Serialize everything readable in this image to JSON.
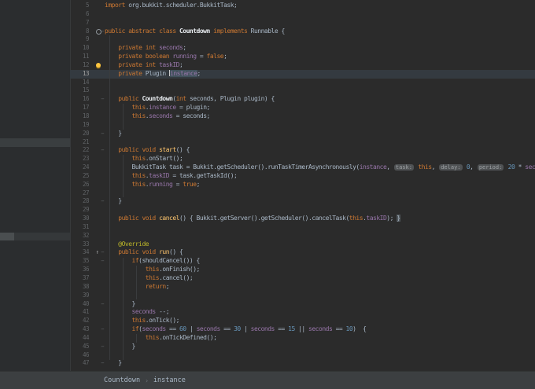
{
  "colors": {
    "bg": "#2b2b2b",
    "panel": "#2b2d2f",
    "bar": "#3c3f41",
    "lineNum": "#606366",
    "lineNumActive": "#a4a3a3",
    "kw": "#cc7832",
    "pl": "#a9b7c6",
    "fld": "#9876aa",
    "mth": "#ffc66d",
    "num": "#6897bb",
    "ann": "#bbb529",
    "cls": "#e8ecf0",
    "hintBg": "#4f5254",
    "hintFg": "#9da1a4",
    "caretLine": "#343a40",
    "sel": "#41525c",
    "brace": "#50565a",
    "crumb": "#a9b7c6",
    "bulb": "#fdc53f"
  },
  "icons": {
    "bulb": "intention-bulb-icon",
    "override": "overriding-method-icon",
    "marker": "class-marker-icon",
    "fold": "fold-marker-icon"
  },
  "breadcrumbs": {
    "items": [
      "Countdown",
      "instance"
    ],
    "separator": "›"
  },
  "editor": {
    "lines": [
      {
        "n": 5,
        "segs": [
          [
            "kw",
            "import"
          ],
          [
            "pl",
            " org.bukkit.scheduler.BukkitTask;"
          ]
        ]
      },
      {
        "n": 6,
        "segs": []
      },
      {
        "n": 7,
        "segs": []
      },
      {
        "n": 8,
        "icon": "marker",
        "fold": true,
        "segs": [
          [
            "kw",
            "public abstract class "
          ],
          [
            "cls",
            "Countdown"
          ],
          [
            "pl",
            " "
          ],
          [
            "kw",
            "implements"
          ],
          [
            "pl",
            " Runnable {"
          ]
        ]
      },
      {
        "n": 9,
        "segs": []
      },
      {
        "n": 10,
        "segs": [
          [
            "pl",
            "    "
          ],
          [
            "kw",
            "private int "
          ],
          [
            "fld",
            "seconds"
          ],
          [
            "pl",
            ";"
          ]
        ]
      },
      {
        "n": 11,
        "segs": [
          [
            "pl",
            "    "
          ],
          [
            "kw",
            "private boolean "
          ],
          [
            "fld",
            "running"
          ],
          [
            "pl",
            " = "
          ],
          [
            "kw",
            "false"
          ],
          [
            "pl",
            ";"
          ]
        ]
      },
      {
        "n": 12,
        "icon": "bulb",
        "segs": [
          [
            "pl",
            "    "
          ],
          [
            "kw",
            "private int "
          ],
          [
            "fld",
            "taskID"
          ],
          [
            "pl",
            ";"
          ]
        ]
      },
      {
        "n": 13,
        "caretLine": true,
        "segs": [
          [
            "pl",
            "    "
          ],
          [
            "kw",
            "private"
          ],
          [
            "pl",
            " Plugin "
          ],
          [
            "caret",
            ""
          ],
          [
            "sel",
            "instance"
          ],
          [
            "pl",
            ";"
          ]
        ]
      },
      {
        "n": 14,
        "segs": []
      },
      {
        "n": 15,
        "segs": []
      },
      {
        "n": 16,
        "fold": true,
        "segs": [
          [
            "pl",
            "    "
          ],
          [
            "kw",
            "public "
          ],
          [
            "cls",
            "Countdown"
          ],
          [
            "pl",
            "("
          ],
          [
            "kw",
            "int"
          ],
          [
            "pl",
            " seconds, Plugin plugin) {"
          ]
        ]
      },
      {
        "n": 17,
        "segs": [
          [
            "pl",
            "        "
          ],
          [
            "kw",
            "this"
          ],
          [
            "pl",
            "."
          ],
          [
            "fld",
            "instance"
          ],
          [
            "pl",
            " = plugin;"
          ]
        ]
      },
      {
        "n": 18,
        "segs": [
          [
            "pl",
            "        "
          ],
          [
            "kw",
            "this"
          ],
          [
            "pl",
            "."
          ],
          [
            "fld",
            "seconds"
          ],
          [
            "pl",
            " = seconds;"
          ]
        ]
      },
      {
        "n": 19,
        "segs": []
      },
      {
        "n": 20,
        "fold": true,
        "segs": [
          [
            "pl",
            "    }"
          ]
        ]
      },
      {
        "n": 21,
        "segs": []
      },
      {
        "n": 22,
        "fold": true,
        "segs": [
          [
            "pl",
            "    "
          ],
          [
            "kw",
            "public void "
          ],
          [
            "mth",
            "start"
          ],
          [
            "pl",
            "() {"
          ]
        ]
      },
      {
        "n": 23,
        "segs": [
          [
            "pl",
            "        "
          ],
          [
            "kw",
            "this"
          ],
          [
            "pl",
            ".onStart();"
          ]
        ]
      },
      {
        "n": 24,
        "segs": [
          [
            "pl",
            "        BukkitTask task = Bukkit.getScheduler().runTaskTimerAsynchronously("
          ],
          [
            "fld",
            "instance"
          ],
          [
            "pl",
            ", "
          ],
          [
            "hint",
            "task:"
          ],
          [
            "pl",
            " "
          ],
          [
            "kw",
            "this"
          ],
          [
            "pl",
            ", "
          ],
          [
            "hint",
            "delay:"
          ],
          [
            "pl",
            " "
          ],
          [
            "num",
            "0"
          ],
          [
            "pl",
            ", "
          ],
          [
            "hint",
            "period:"
          ],
          [
            "pl",
            " "
          ],
          [
            "num",
            "20"
          ],
          [
            "pl",
            " * "
          ],
          [
            "fld",
            "seconds"
          ],
          [
            "pl",
            ");"
          ]
        ]
      },
      {
        "n": 25,
        "segs": [
          [
            "pl",
            "        "
          ],
          [
            "kw",
            "this"
          ],
          [
            "pl",
            "."
          ],
          [
            "fld",
            "taskID"
          ],
          [
            "pl",
            " = task.getTaskId();"
          ]
        ]
      },
      {
        "n": 26,
        "segs": [
          [
            "pl",
            "        "
          ],
          [
            "kw",
            "this"
          ],
          [
            "pl",
            "."
          ],
          [
            "fld",
            "running"
          ],
          [
            "pl",
            " = "
          ],
          [
            "kw",
            "true"
          ],
          [
            "pl",
            ";"
          ]
        ]
      },
      {
        "n": 27,
        "segs": []
      },
      {
        "n": 28,
        "fold": true,
        "segs": [
          [
            "pl",
            "    }"
          ]
        ]
      },
      {
        "n": 29,
        "segs": []
      },
      {
        "n": 30,
        "segs": [
          [
            "pl",
            "    "
          ],
          [
            "kw",
            "public void "
          ],
          [
            "mth",
            "cancel"
          ],
          [
            "pl",
            "() { Bukkit.getServer().getScheduler().cancelTask("
          ],
          [
            "kw",
            "this"
          ],
          [
            "pl",
            "."
          ],
          [
            "fld",
            "taskID"
          ],
          [
            "pl",
            "); "
          ],
          [
            "brc",
            "}"
          ]
        ]
      },
      {
        "n": 31,
        "segs": []
      },
      {
        "n": 32,
        "segs": []
      },
      {
        "n": 33,
        "segs": [
          [
            "pl",
            "    "
          ],
          [
            "ann",
            "@Override"
          ]
        ]
      },
      {
        "n": 34,
        "icon": "override",
        "fold": true,
        "segs": [
          [
            "pl",
            "    "
          ],
          [
            "kw",
            "public void "
          ],
          [
            "mth",
            "run"
          ],
          [
            "pl",
            "() {"
          ]
        ]
      },
      {
        "n": 35,
        "fold": true,
        "segs": [
          [
            "pl",
            "        "
          ],
          [
            "kw",
            "if"
          ],
          [
            "pl",
            "(shouldCancel()) {"
          ]
        ]
      },
      {
        "n": 36,
        "segs": [
          [
            "pl",
            "            "
          ],
          [
            "kw",
            "this"
          ],
          [
            "pl",
            ".onFinish();"
          ]
        ]
      },
      {
        "n": 37,
        "segs": [
          [
            "pl",
            "            "
          ],
          [
            "kw",
            "this"
          ],
          [
            "pl",
            ".cancel();"
          ]
        ]
      },
      {
        "n": 38,
        "segs": [
          [
            "pl",
            "            "
          ],
          [
            "kw",
            "return"
          ],
          [
            "pl",
            ";"
          ]
        ]
      },
      {
        "n": 39,
        "segs": []
      },
      {
        "n": 40,
        "fold": true,
        "segs": [
          [
            "pl",
            "        }"
          ]
        ]
      },
      {
        "n": 41,
        "segs": [
          [
            "pl",
            "        "
          ],
          [
            "fld",
            "seconds"
          ],
          [
            "pl",
            " --;"
          ]
        ]
      },
      {
        "n": 42,
        "segs": [
          [
            "pl",
            "        "
          ],
          [
            "kw",
            "this"
          ],
          [
            "pl",
            ".onTick();"
          ]
        ]
      },
      {
        "n": 43,
        "fold": true,
        "segs": [
          [
            "pl",
            "        "
          ],
          [
            "kw",
            "if"
          ],
          [
            "pl",
            "("
          ],
          [
            "fld",
            "seconds"
          ],
          [
            "pl",
            " == "
          ],
          [
            "num",
            "60"
          ],
          [
            "pl",
            " | "
          ],
          [
            "fld",
            "seconds"
          ],
          [
            "pl",
            " == "
          ],
          [
            "num",
            "30"
          ],
          [
            "pl",
            " | "
          ],
          [
            "fld",
            "seconds"
          ],
          [
            "pl",
            " == "
          ],
          [
            "num",
            "15"
          ],
          [
            "pl",
            " || "
          ],
          [
            "fld",
            "seconds"
          ],
          [
            "pl",
            " == "
          ],
          [
            "num",
            "10"
          ],
          [
            "pl",
            ")  {"
          ]
        ]
      },
      {
        "n": 44,
        "segs": [
          [
            "pl",
            "            "
          ],
          [
            "kw",
            "this"
          ],
          [
            "pl",
            ".onTickDefined();"
          ]
        ]
      },
      {
        "n": 45,
        "fold": true,
        "segs": [
          [
            "pl",
            "        }"
          ]
        ]
      },
      {
        "n": 46,
        "segs": []
      },
      {
        "n": 47,
        "fold": true,
        "segs": [
          [
            "pl",
            "    }"
          ]
        ]
      }
    ]
  }
}
